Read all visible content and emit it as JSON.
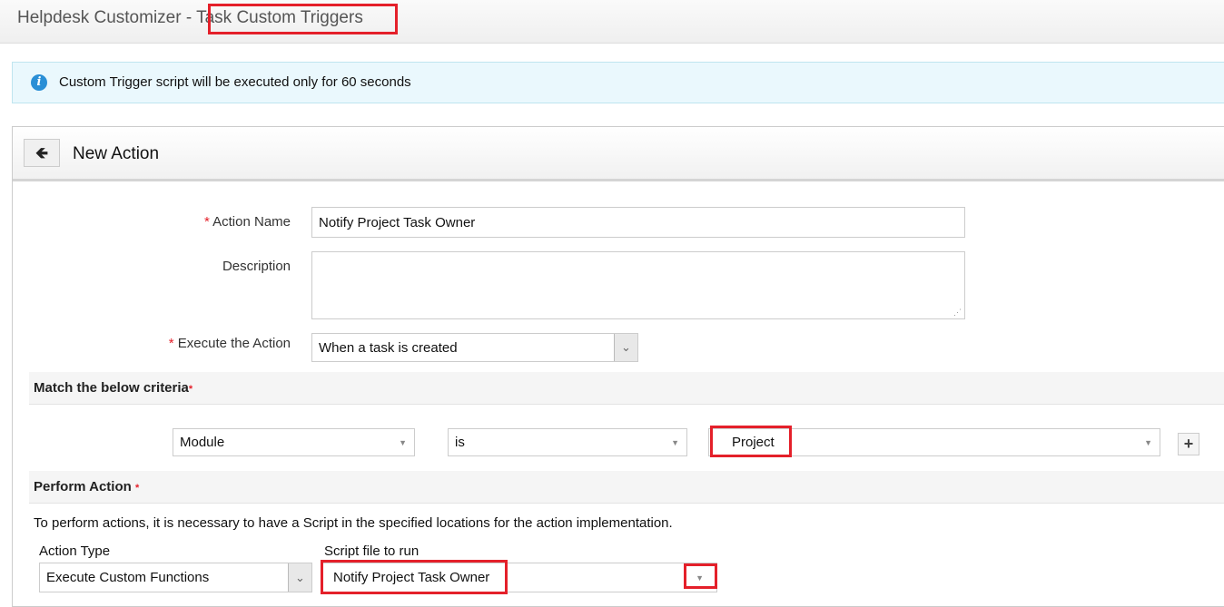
{
  "header": {
    "title_prefix": "Helpdesk Customizer - ",
    "title_highlight": "Task Custom Triggers"
  },
  "info": {
    "icon": "info-icon",
    "text": "Custom Trigger script will be executed only for 60 seconds"
  },
  "panel": {
    "title": "New Action",
    "back_icon": "arrow-left-icon"
  },
  "form": {
    "required_mark": "*",
    "action_name_label": "Action Name",
    "action_name_value": "Notify Project Task Owner",
    "description_label": "Description",
    "description_value": "",
    "execute_label": "Execute the Action",
    "execute_value": "When a task is created"
  },
  "criteria": {
    "heading": "Match the below criteria",
    "field": "Module",
    "operator": "is",
    "value": "Project",
    "add_label": "+"
  },
  "perform": {
    "heading": "Perform Action",
    "note": "To perform actions, it is necessary to have a Script in the specified locations for the action implementation.",
    "action_type_label": "Action Type",
    "action_type_value": "Execute Custom Functions",
    "script_label": "Script file to run",
    "script_value": "Notify Project Task Owner"
  },
  "colors": {
    "highlight": "#e4202a",
    "info_bg": "#eaf8fd"
  }
}
